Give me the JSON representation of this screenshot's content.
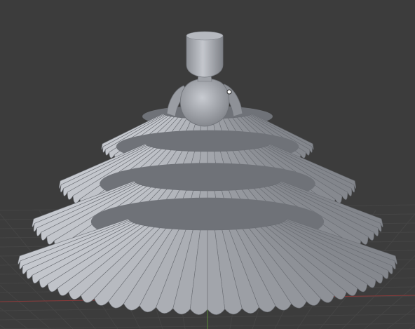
{
  "viewport": {
    "background_color": "#3c3c3c",
    "grid_color": "#454545",
    "x_axis_color": "#8a3a3a",
    "y_axis_color": "#5a8a3a",
    "model_base_color": "#a9acb2",
    "model_shadow_color": "#6f7278",
    "model_highlight_color": "#cfd2d8"
  },
  "scene": {
    "object": "dress-mannequin-model",
    "ruffle_tiers": 4,
    "selected_vertex_visible": true
  }
}
